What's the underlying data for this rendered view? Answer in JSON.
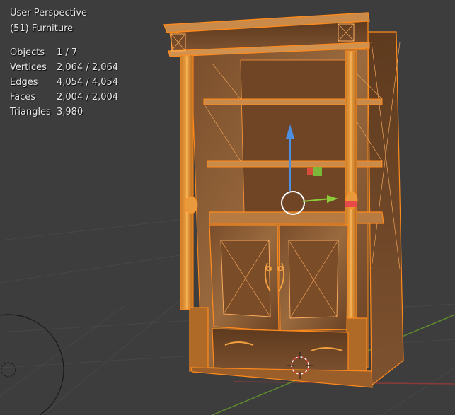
{
  "viewport": {
    "title": "User Perspective",
    "collection": "(51) Furniture",
    "stats": [
      {
        "label": "Objects",
        "value": "1 / 7"
      },
      {
        "label": "Vertices",
        "value": "2,064 / 2,064"
      },
      {
        "label": "Edges",
        "value": "4,054 / 4,054"
      },
      {
        "label": "Faces",
        "value": "2,004 / 2,004"
      },
      {
        "label": "Triangles",
        "value": "3,980"
      }
    ]
  },
  "colors": {
    "background": "#3d3d3d",
    "selection_outline": "#ff8a1c",
    "wood": "#8a5a32",
    "gizmo_z": "#4d8fe0",
    "gizmo_y": "#8ccc3a",
    "gizmo_x": "#e84a4a"
  }
}
